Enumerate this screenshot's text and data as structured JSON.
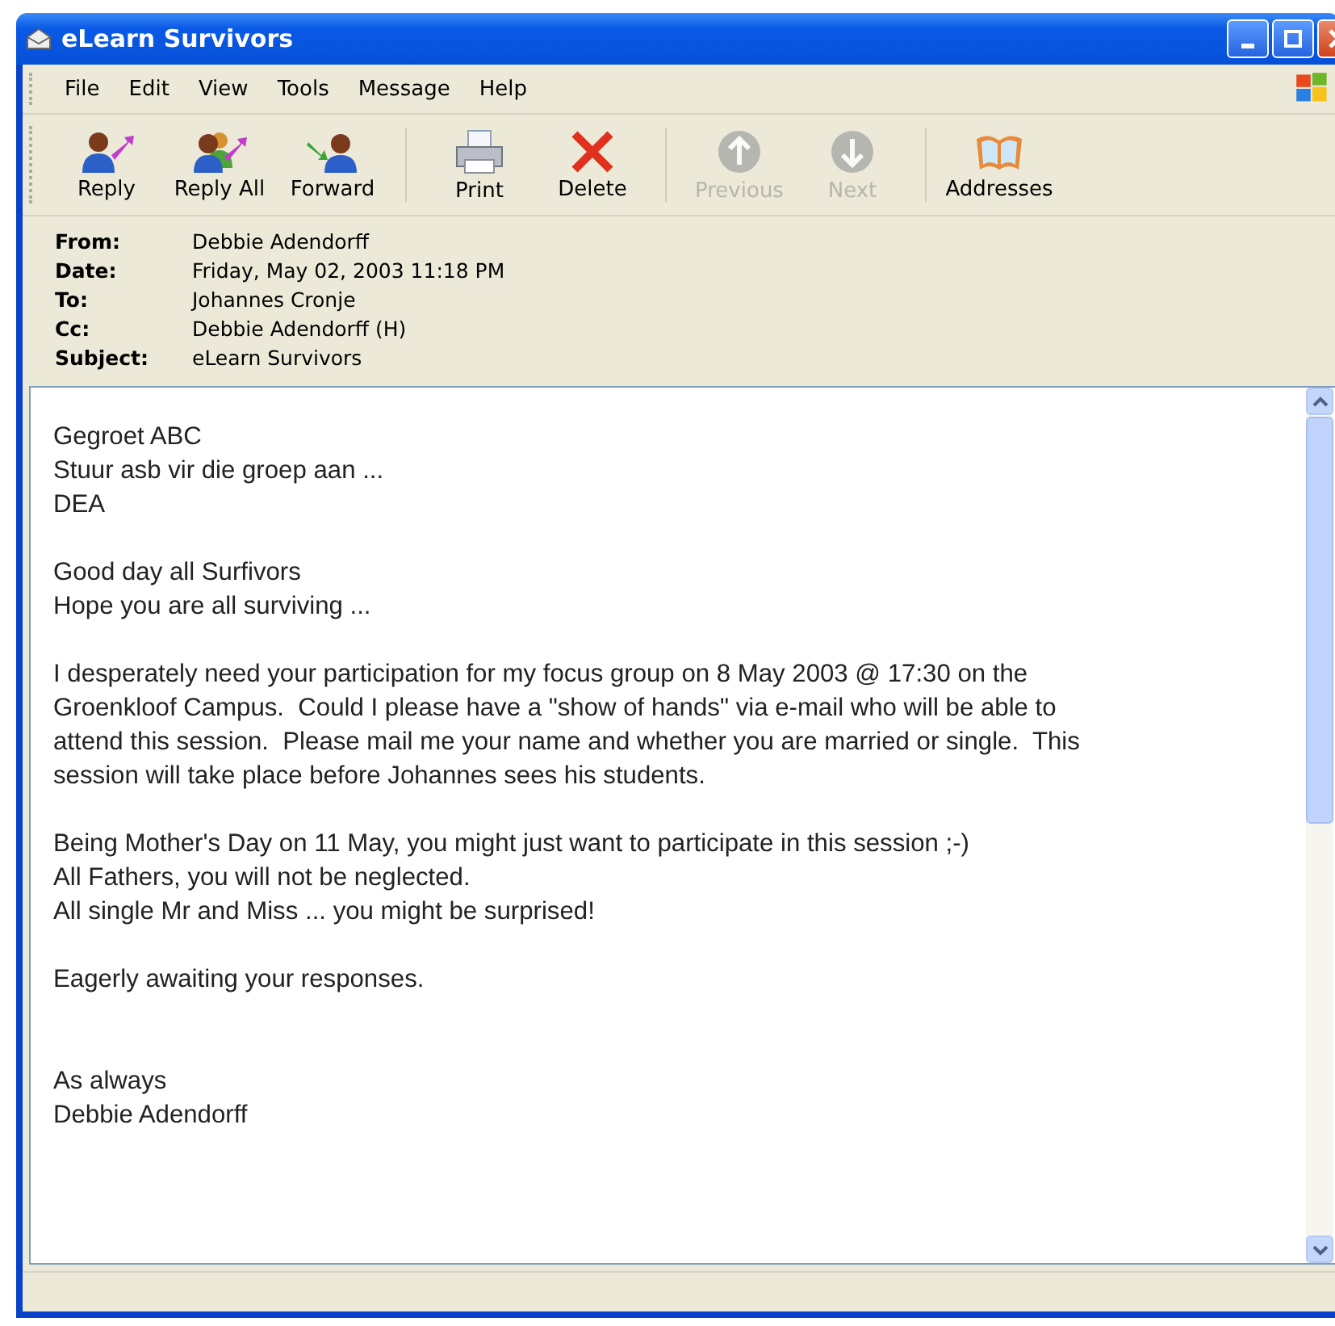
{
  "window": {
    "title": "eLearn Survivors"
  },
  "menu": [
    "File",
    "Edit",
    "View",
    "Tools",
    "Message",
    "Help"
  ],
  "toolbar": [
    {
      "label": "Reply",
      "kind": "reply",
      "disabled": false
    },
    {
      "label": "Reply All",
      "kind": "reply-all",
      "disabled": false
    },
    {
      "label": "Forward",
      "kind": "forward",
      "disabled": false
    },
    {
      "label": "Print",
      "kind": "print",
      "disabled": false
    },
    {
      "label": "Delete",
      "kind": "delete",
      "disabled": false
    },
    {
      "label": "Previous",
      "kind": "previous",
      "disabled": true
    },
    {
      "label": "Next",
      "kind": "next",
      "disabled": true
    },
    {
      "label": "Addresses",
      "kind": "addresses",
      "disabled": false
    }
  ],
  "headers": [
    {
      "label": "From:",
      "value": "Debbie Adendorff"
    },
    {
      "label": "Date:",
      "value": "Friday, May 02, 2003 11:18 PM"
    },
    {
      "label": "To:",
      "value": "Johannes Cronje"
    },
    {
      "label": "Cc:",
      "value": "Debbie Adendorff (H)"
    },
    {
      "label": "Subject:",
      "value": "eLearn Survivors"
    }
  ],
  "body": [
    [
      "Gegroet ABC",
      "Stuur asb vir die groep aan ...",
      "DEA"
    ],
    [
      "Good day all Surfivors",
      "Hope you are all surviving ..."
    ],
    [
      "I desperately need your participation for my focus group on 8 May 2003 @ 17:30 on the",
      "Groenkloof Campus.  Could I please have a \"show of hands\" via e-mail who will be able to",
      "attend this session.  Please mail me your name and whether you are married or single.  This",
      "session will take place before Johannes sees his students."
    ],
    [
      "Being Mother's Day on 11 May, you might just want to participate in this session ;-)",
      "All Fathers, you will not be neglected.",
      "All single Mr and Miss ... you might be surprised!"
    ],
    [
      "Eagerly awaiting your responses."
    ],
    [
      "As always",
      "Debbie Adendorff"
    ]
  ]
}
